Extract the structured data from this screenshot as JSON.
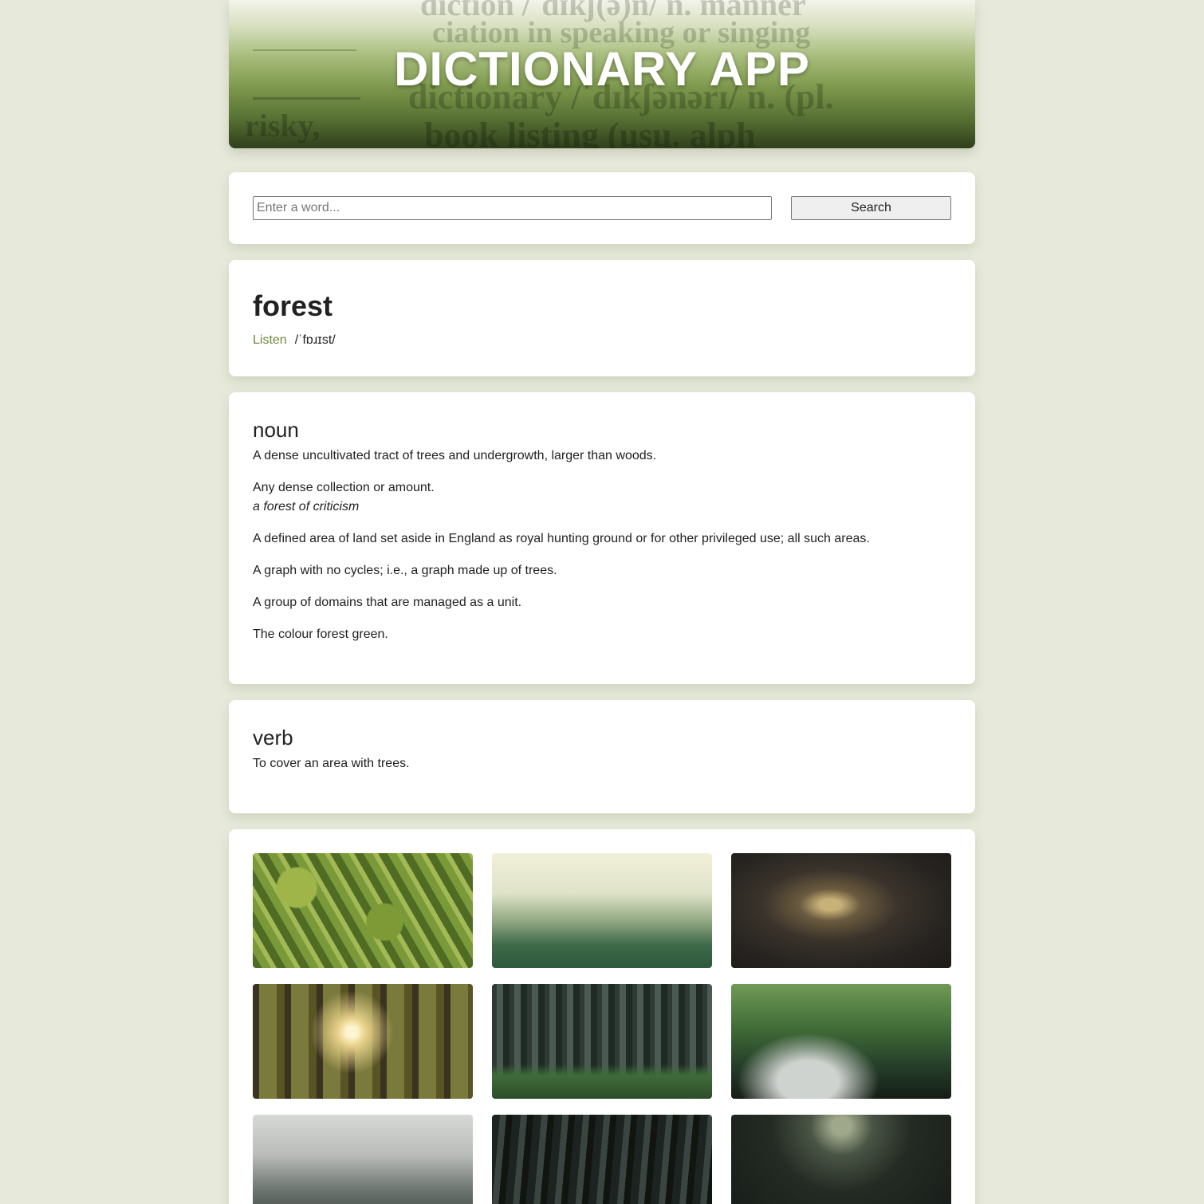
{
  "header": {
    "title": "DICTIONARY APP",
    "background_words": [
      "diction /ˈdɪkʃ(ə)n/ n. manner",
      "ciation in speaking or singing",
      "dictionary /ˈdɪkʃənərɪ/ n. (pl.",
      "risky,",
      "book listing (usu. alph"
    ]
  },
  "search": {
    "placeholder": "Enter a word...",
    "value": "",
    "button_label": "Search"
  },
  "entry": {
    "word": "forest",
    "listen_label": "Listen",
    "phonetic": "/ˈfɒɹɪst/"
  },
  "meanings": [
    {
      "part_of_speech": "noun",
      "definitions": [
        {
          "text": "A dense uncultivated tract of trees and undergrowth, larger than woods.",
          "example": ""
        },
        {
          "text": "Any dense collection or amount.",
          "example": "a forest of criticism"
        },
        {
          "text": "A defined area of land set aside in England as royal hunting ground or for other privileged use; all such areas.",
          "example": ""
        },
        {
          "text": "A graph with no cycles; i.e., a graph made up of trees.",
          "example": ""
        },
        {
          "text": "A group of domains that are managed as a unit.",
          "example": ""
        },
        {
          "text": "The colour forest green.",
          "example": ""
        }
      ]
    },
    {
      "part_of_speech": "verb",
      "definitions": [
        {
          "text": "To cover an area with trees.",
          "example": ""
        }
      ]
    }
  ],
  "gallery": {
    "images": [
      {
        "subject": "aerial conifer forest"
      },
      {
        "subject": "misty pine forest"
      },
      {
        "subject": "dark tree tunnel path"
      },
      {
        "subject": "sunlit forest trees"
      },
      {
        "subject": "tall pine trunks with ferns"
      },
      {
        "subject": "misty green forest with rocks"
      },
      {
        "subject": "foggy treetops"
      },
      {
        "subject": "dark forest trunks"
      },
      {
        "subject": "dark forest corridor"
      }
    ]
  },
  "colors": {
    "page_background": "#e7eadb",
    "accent_link": "#6f8a3f",
    "card_background": "#ffffff"
  }
}
